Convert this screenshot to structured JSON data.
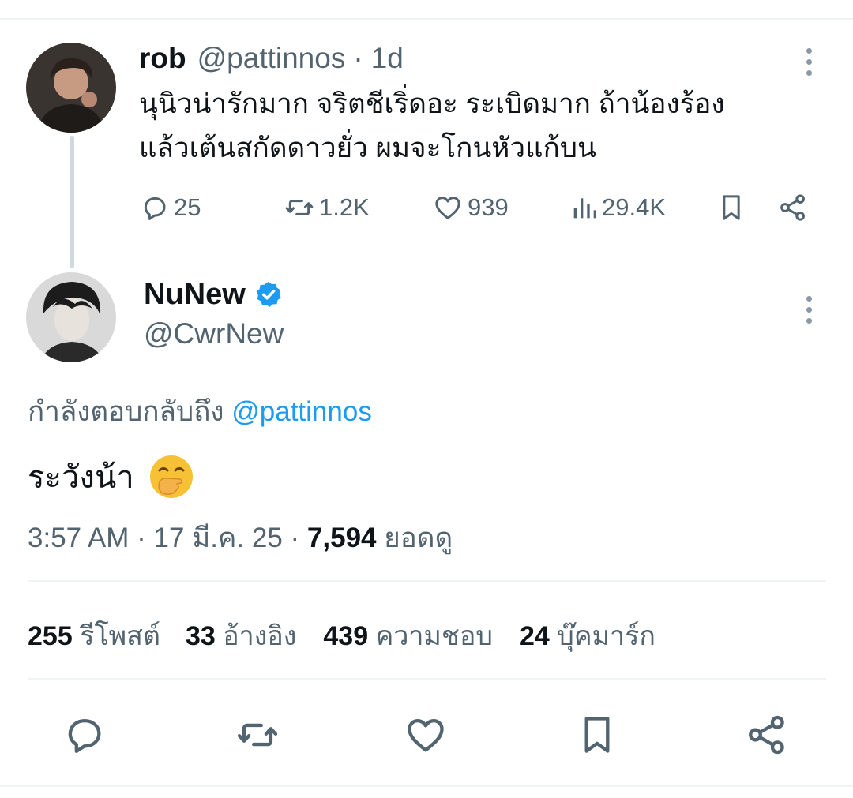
{
  "parent_post": {
    "name": "rob",
    "handle": "@pattinnos",
    "separator": "·",
    "time": "1d",
    "text_line1": "นุนิวน่ารักมาก จริตชีเริ่ดอะ ระเบิดมาก ถ้าน้องร้อง",
    "text_line2": "แล้วเต้นสกัดดาวยั่ว ผมจะโกนหัวแก้บน",
    "metrics": {
      "replies": "25",
      "reposts": "1.2K",
      "likes": "939",
      "views": "29.4K"
    },
    "icons": [
      "reply-icon",
      "repost-icon",
      "like-icon",
      "views-icon",
      "bookmark-icon",
      "share-icon",
      "more-icon"
    ]
  },
  "main_post": {
    "name": "NuNew",
    "handle": "@CwrNew",
    "verified": true,
    "reply_prefix": "กำลังตอบกลับถึง",
    "reply_mention": "@pattinnos",
    "text": "ระวังน้า",
    "emoji": "🤭",
    "time": "3:57 AM",
    "date": "17 มี.ค. 25",
    "dot": "·",
    "views_count": "7,594",
    "views_label": "ยอดดู"
  },
  "stats": {
    "reposts_count": "255",
    "reposts_label": "รีโพสต์",
    "quotes_count": "33",
    "quotes_label": "อ้างอิง",
    "likes_count": "439",
    "likes_label": "ความชอบ",
    "bookmarks_count": "24",
    "bookmarks_label": "บุ๊คมาร์ก"
  },
  "colors": {
    "accent": "#1d9bf0",
    "secondary_text": "#536471",
    "primary_text": "#0f1419",
    "divider": "#eff3f4"
  }
}
